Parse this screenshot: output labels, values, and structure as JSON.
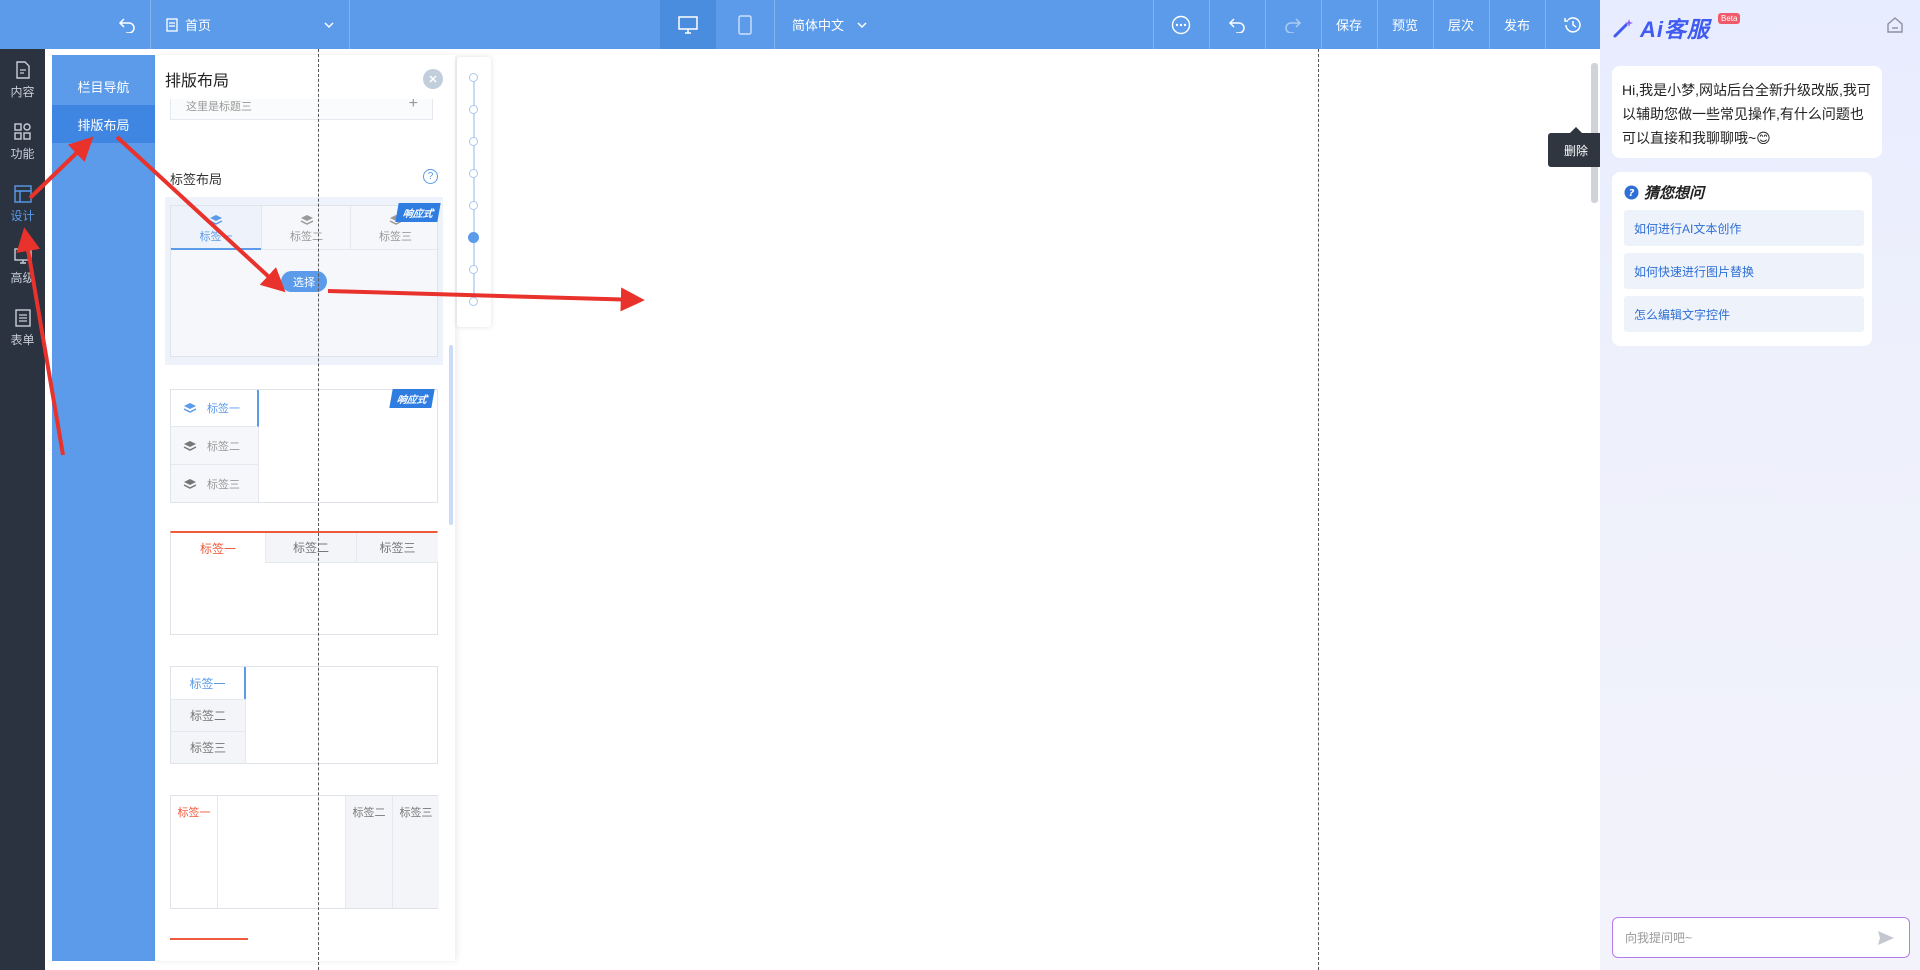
{
  "topbar": {
    "page_select": "首页",
    "language": "简体中文",
    "save": "保存",
    "preview": "预览",
    "layers": "层次",
    "publish": "发布"
  },
  "rail": {
    "items": [
      {
        "label": "内容",
        "icon": "document-icon"
      },
      {
        "label": "功能",
        "icon": "grid-icon"
      },
      {
        "label": "设计",
        "icon": "layout-icon"
      },
      {
        "label": "高级",
        "icon": "monitor-icon"
      },
      {
        "label": "表单",
        "icon": "list-icon"
      }
    ]
  },
  "subnav": {
    "items": [
      "栏目导航",
      "排版布局"
    ]
  },
  "panel": {
    "title": "排版布局",
    "partial_row": "这里是标题三",
    "section_label": "标签布局",
    "help": "?",
    "badge": "响应式",
    "select_button": "选择",
    "tabs": [
      "标签一",
      "标签二",
      "标签三"
    ]
  },
  "canvas": {
    "tooltip": "删除"
  },
  "ai": {
    "logo": "Ai客服",
    "beta": "Beta",
    "greeting": "Hi,我是小梦,网站后台全新升级改版,我可以辅助您做一些常见操作,有什么问题也可以直接和我聊聊哦~😊",
    "guess_title": "猜您想问",
    "questions": [
      "如何进行AI文本创作",
      "如何快速进行图片替换",
      "怎么编辑文字控件"
    ],
    "input_placeholder": "向我提问吧~"
  },
  "colors": {
    "topbar": "#5b9be9",
    "rail": "#2b3240",
    "accent": "#5b9be9",
    "arrow": "#e8322b",
    "tab_red": "#f05a3c"
  }
}
